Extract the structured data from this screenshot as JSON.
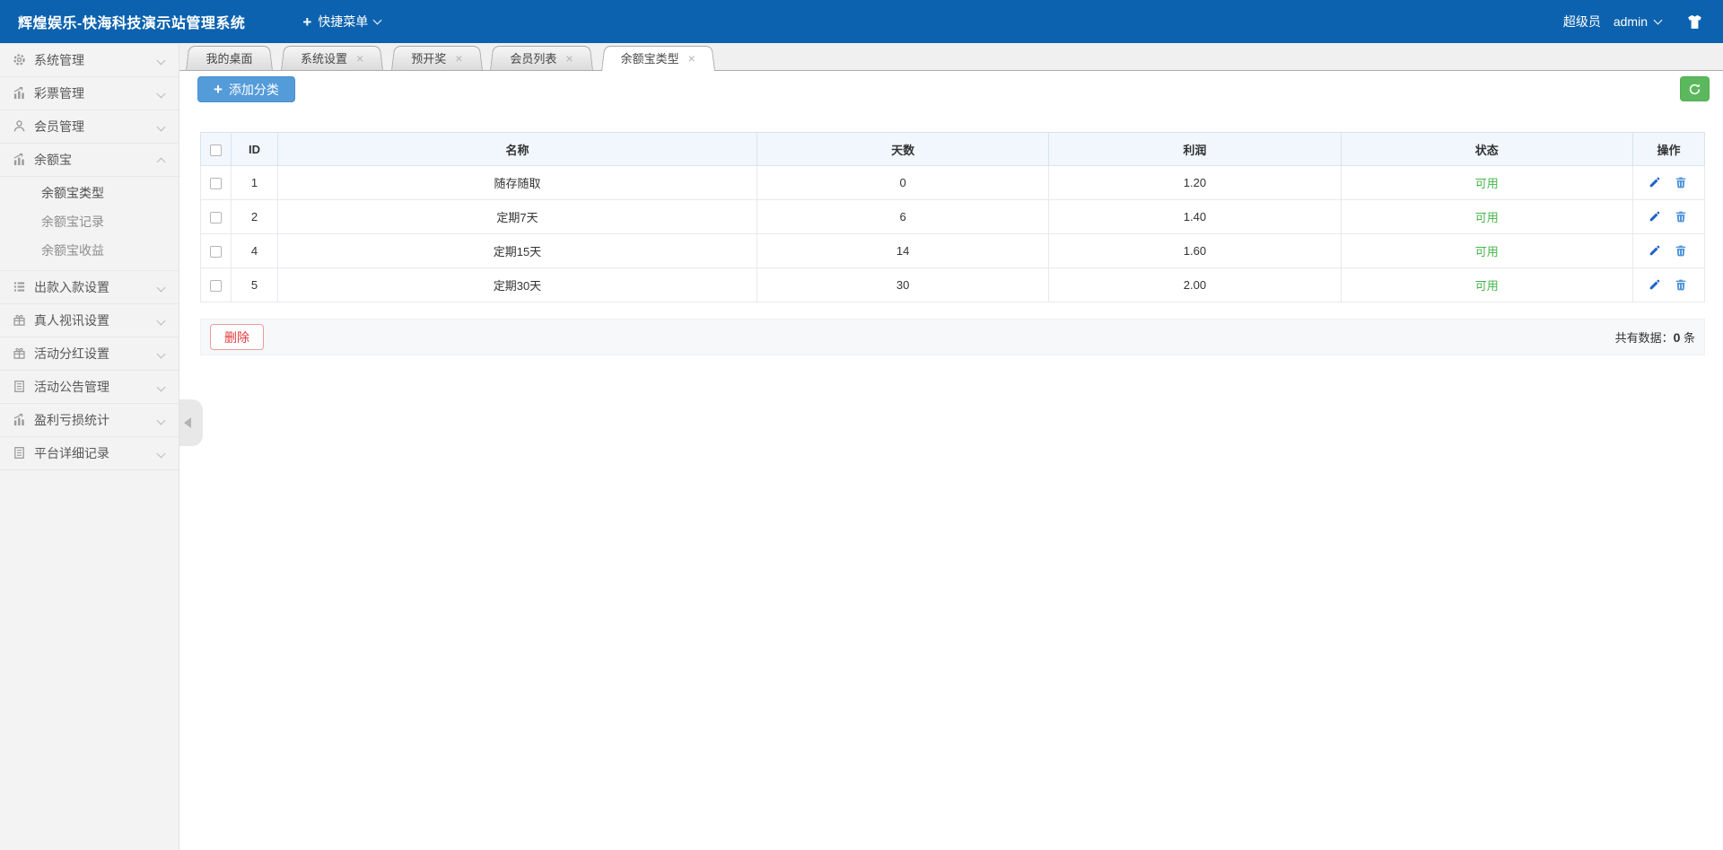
{
  "topbar": {
    "title": "辉煌娱乐-快海科技演示站管理系统",
    "quick_menu_label": "快捷菜单",
    "role_label": "超级员",
    "username": "admin",
    "icons": [
      "plus-icon",
      "chevron-down-icon",
      "tshirt-icon"
    ]
  },
  "sidebar": {
    "items": [
      {
        "label": "系统管理",
        "icon": "gear-icon",
        "expanded": false
      },
      {
        "label": "彩票管理",
        "icon": "chart-icon",
        "expanded": false
      },
      {
        "label": "会员管理",
        "icon": "user-icon",
        "expanded": false
      },
      {
        "label": "余额宝",
        "icon": "chart-icon",
        "expanded": true,
        "children": [
          {
            "label": "余额宝类型",
            "active": true
          },
          {
            "label": "余额宝记录",
            "active": false
          },
          {
            "label": "余额宝收益",
            "active": false
          }
        ]
      },
      {
        "label": "出款入款设置",
        "icon": "list-icon",
        "expanded": false
      },
      {
        "label": "真人视讯设置",
        "icon": "gift-icon",
        "expanded": false
      },
      {
        "label": "活动分红设置",
        "icon": "gift-icon",
        "expanded": false
      },
      {
        "label": "活动公告管理",
        "icon": "document-icon",
        "expanded": false
      },
      {
        "label": "盈利亏损统计",
        "icon": "chart-icon",
        "expanded": false
      },
      {
        "label": "平台详细记录",
        "icon": "document-icon",
        "expanded": false
      }
    ]
  },
  "tabs": [
    {
      "label": "我的桌面",
      "closable": false,
      "active": false
    },
    {
      "label": "系统设置",
      "closable": true,
      "active": false
    },
    {
      "label": "预开奖",
      "closable": true,
      "active": false
    },
    {
      "label": "会员列表",
      "closable": true,
      "active": false
    },
    {
      "label": "余额宝类型",
      "closable": true,
      "active": true
    }
  ],
  "toolbar": {
    "add_button_label": "添加分类",
    "refresh_icon": "refresh-icon"
  },
  "table": {
    "columns": [
      "ID",
      "名称",
      "天数",
      "利润",
      "状态",
      "操作"
    ],
    "row_action_icons": [
      "edit-icon",
      "trash-icon"
    ],
    "rows": [
      {
        "id": "1",
        "name": "随存随取",
        "days": "0",
        "profit": "1.20",
        "status": "可用"
      },
      {
        "id": "2",
        "name": "定期7天",
        "days": "6",
        "profit": "1.40",
        "status": "可用"
      },
      {
        "id": "4",
        "name": "定期15天",
        "days": "14",
        "profit": "1.60",
        "status": "可用"
      },
      {
        "id": "5",
        "name": "定期30天",
        "days": "30",
        "profit": "2.00",
        "status": "可用"
      }
    ]
  },
  "footer": {
    "delete_button_label": "删除",
    "total_label_prefix": "共有数据：",
    "total_count": "0",
    "total_label_suffix": " 条"
  },
  "colors": {
    "topbar_bg": "#0c62ae",
    "add_button": "#549bd9",
    "refresh_button": "#5cb85c",
    "status_available": "#44b549",
    "delete_accent": "#e4393c",
    "edit_icon": "#1e62c8",
    "trash_icon": "#4f94d9"
  }
}
